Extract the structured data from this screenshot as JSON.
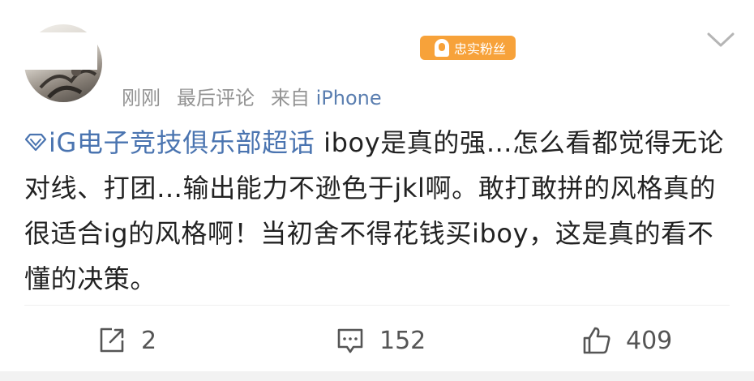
{
  "badge": {
    "label": "忠实粉丝",
    "icon": "fan-badge-icon"
  },
  "menu": {
    "icon": "chevron-down-icon"
  },
  "meta": {
    "time": "刚刚",
    "status": "最后评论",
    "source_prefix": "来自",
    "source_device": "iPhone"
  },
  "post": {
    "supertopic": "iG电子竞技俱乐部超话",
    "supertopic_icon": "supertopic-diamond-icon",
    "text": "iboy是真的强…怎么看都觉得无论对线、打团…输出能力不逊色于jkl啊。敢打敢拼的风格真的很适合ig的风格啊！当初舍不得花钱买iboy，这是真的看不懂的决策。"
  },
  "actions": {
    "repost_count": "2",
    "comment_count": "152",
    "like_count": "409"
  },
  "colors": {
    "accent_link": "#4a74b0",
    "badge_bg": "#f7a23a",
    "meta_gray": "#939393"
  }
}
